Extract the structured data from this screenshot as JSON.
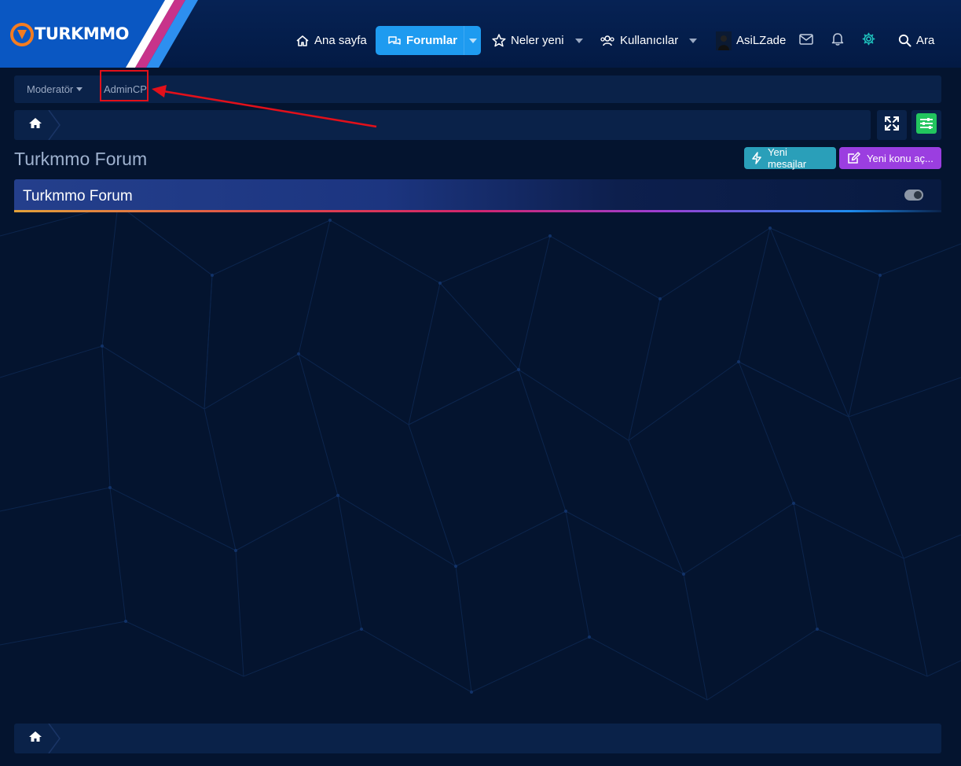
{
  "logo": {
    "text": "TURKMMO",
    "icon": "turkmmo-logo-icon"
  },
  "nav": {
    "home": {
      "label": "Ana sayfa",
      "icon": "home-icon"
    },
    "forums": {
      "label": "Forumlar",
      "icon": "chat-bubbles-icon",
      "active": true
    },
    "whats_new": {
      "label": "Neler yeni",
      "icon": "star-icon"
    },
    "members": {
      "label": "Kullanıcılar",
      "icon": "users-icon"
    },
    "user": {
      "label": "AsiLZade",
      "icon": "avatar"
    },
    "inbox_icon": "envelope-icon",
    "alerts_icon": "bell-icon",
    "settings_icon": "gear-icon",
    "search": {
      "label": "Ara",
      "icon": "search-icon"
    }
  },
  "subnav": {
    "moderator": "Moderatör",
    "admincp": "AdminCP"
  },
  "page": {
    "title": "Turkmmo Forum",
    "new_posts": "Yeni mesajlar",
    "new_thread": "Yeni konu aç..."
  },
  "forum_block": {
    "title": "Turkmmo Forum"
  },
  "colors": {
    "page_bg": "#04142f",
    "header_bg": "#062254",
    "active_nav": "#1e9bf0",
    "new_posts_btn": "#2a9fb9",
    "new_thread_btn": "#9b3ee0",
    "green_btn": "#22c55e",
    "annotation": "#e2101a"
  }
}
